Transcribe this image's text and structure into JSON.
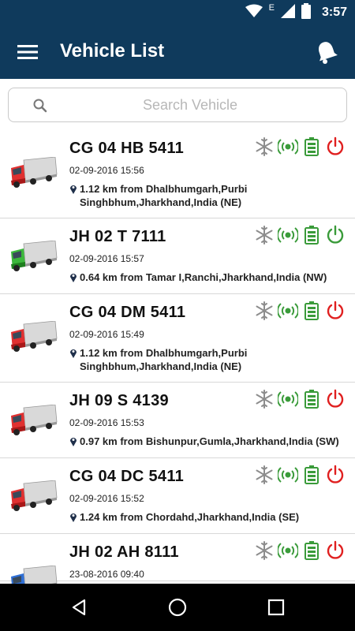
{
  "status_bar": {
    "time": "3:57",
    "network_letter": "E"
  },
  "app_bar": {
    "title": "Vehicle List"
  },
  "search": {
    "placeholder": "Search Vehicle"
  },
  "colors": {
    "primary": "#0f3a5c",
    "green": "#3a9b3a",
    "red": "#e02020",
    "grey_icon": "#8d8d8d"
  },
  "vehicles": [
    {
      "number": "CG 04 HB 5411",
      "datetime": "02-09-2016 15:56",
      "location": "1.12 km from Dhalbhumgarh,Purbi Singhbhum,Jharkhand,India (NE)",
      "truck_color": "red",
      "power": "off"
    },
    {
      "number": "JH 02 T 7111",
      "datetime": "02-09-2016 15:57",
      "location": "0.64 km from Tamar I,Ranchi,Jharkhand,India (NW)",
      "truck_color": "green",
      "power": "on"
    },
    {
      "number": "CG 04 DM 5411",
      "datetime": "02-09-2016 15:49",
      "location": "1.12 km from Dhalbhumgarh,Purbi Singhbhum,Jharkhand,India (NE)",
      "truck_color": "red",
      "power": "off"
    },
    {
      "number": "JH 09 S 4139",
      "datetime": "02-09-2016 15:53",
      "location": "0.97 km from Bishunpur,Gumla,Jharkhand,India (SW)",
      "truck_color": "red",
      "power": "off"
    },
    {
      "number": "CG 04 DC 5411",
      "datetime": "02-09-2016 15:52",
      "location": "1.24 km from Chordahd,Jharkhand,India (SE)",
      "truck_color": "red",
      "power": "off"
    },
    {
      "number": "JH 02 AH 8111",
      "datetime": "23-08-2016 09:40",
      "location": "",
      "truck_color": "blue",
      "power": "off"
    }
  ],
  "icons": {
    "row_icons": [
      "snowflake-icon",
      "signal-icon",
      "battery-icon",
      "power-icon"
    ],
    "nav": [
      "back-icon",
      "home-icon",
      "recents-icon"
    ]
  }
}
